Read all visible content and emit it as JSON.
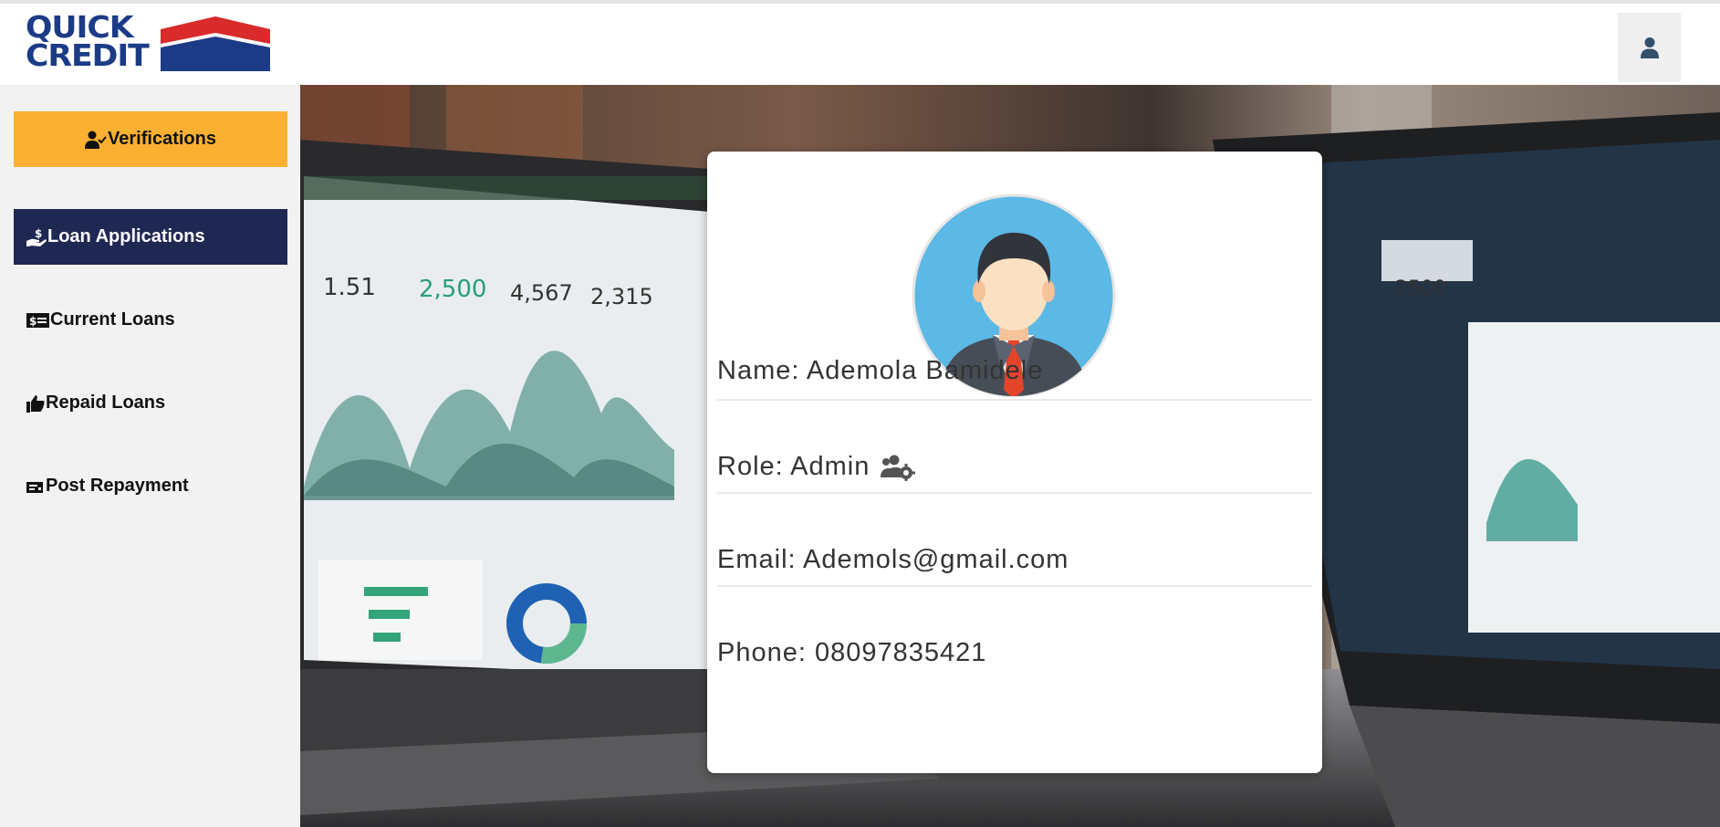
{
  "header": {
    "logo_line1": "QUICK",
    "logo_line2": "CREDIT",
    "user_button_icon": "user-icon"
  },
  "sidebar": {
    "items": [
      {
        "label": "Verifications",
        "icon": "user-check-icon",
        "active": false,
        "highlight": true
      },
      {
        "label": "Loan Applications",
        "icon": "hand-holding-dollar-icon",
        "active": true
      },
      {
        "label": "Current Loans",
        "icon": "money-bill-icon",
        "active": false
      },
      {
        "label": "Repaid Loans",
        "icon": "thumbs-up-icon",
        "active": false
      },
      {
        "label": "Post Repayment",
        "icon": "money-check-icon",
        "active": false
      }
    ]
  },
  "profile": {
    "avatar": "businessman-avatar",
    "name": "Name: Ademola Bamidele",
    "role": "Role: Admin",
    "role_icon": "users-cog-icon",
    "email": "Email: Ademols@gmail.com",
    "phone": "Phone: 08097835421"
  },
  "colors": {
    "logo_blue": "#1c3b87",
    "logo_red": "#d92b2b",
    "verifications_bg": "#fbb032",
    "active_nav_bg": "#1f2853",
    "sidebar_bg": "#f2f2f2"
  }
}
